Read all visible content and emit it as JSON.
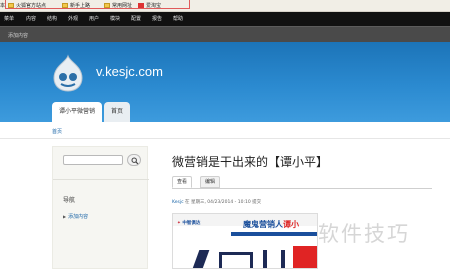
{
  "browser": {
    "bookmarks": [
      {
        "label": "本",
        "icon": "none"
      },
      {
        "label": "火狐官方站点",
        "icon": "folder-icon"
      },
      {
        "label": "新手上路",
        "icon": "folder-icon"
      },
      {
        "label": "常用网址",
        "icon": "folder-icon"
      },
      {
        "label": "爱淘宝",
        "icon": "red-square-icon"
      }
    ]
  },
  "admin_toolbar": {
    "items": [
      "菜单",
      "内容",
      "结构",
      "外观",
      "用户",
      "模块",
      "配置",
      "报告",
      "帮助"
    ],
    "shortcut": "添加内容"
  },
  "site": {
    "name": "v.kesjc.com",
    "tabs": [
      "谭小平微营销",
      "首页"
    ]
  },
  "breadcrumb": "首页",
  "sidebar": {
    "search_placeholder": "",
    "nav_title": "导航",
    "nav_links": [
      "添加内容"
    ]
  },
  "node": {
    "title": "微营销是干出来的【谭小平】",
    "tabs": [
      "查看",
      "编辑"
    ],
    "author": "Kesjc",
    "submitted_rest": " 在 星期三, 04/23/2014 - 10:10 提交"
  },
  "article_image": {
    "logo_brand": "中智俱达",
    "headline_main": "魔鬼营销人",
    "headline_red": "谭小"
  },
  "watermark": "软件技巧",
  "colors": {
    "header_blue": "#2b8ad0",
    "admin_bar": "#111111",
    "link_blue": "#1b66a8",
    "bookmark_bar": "#f1eee6"
  }
}
